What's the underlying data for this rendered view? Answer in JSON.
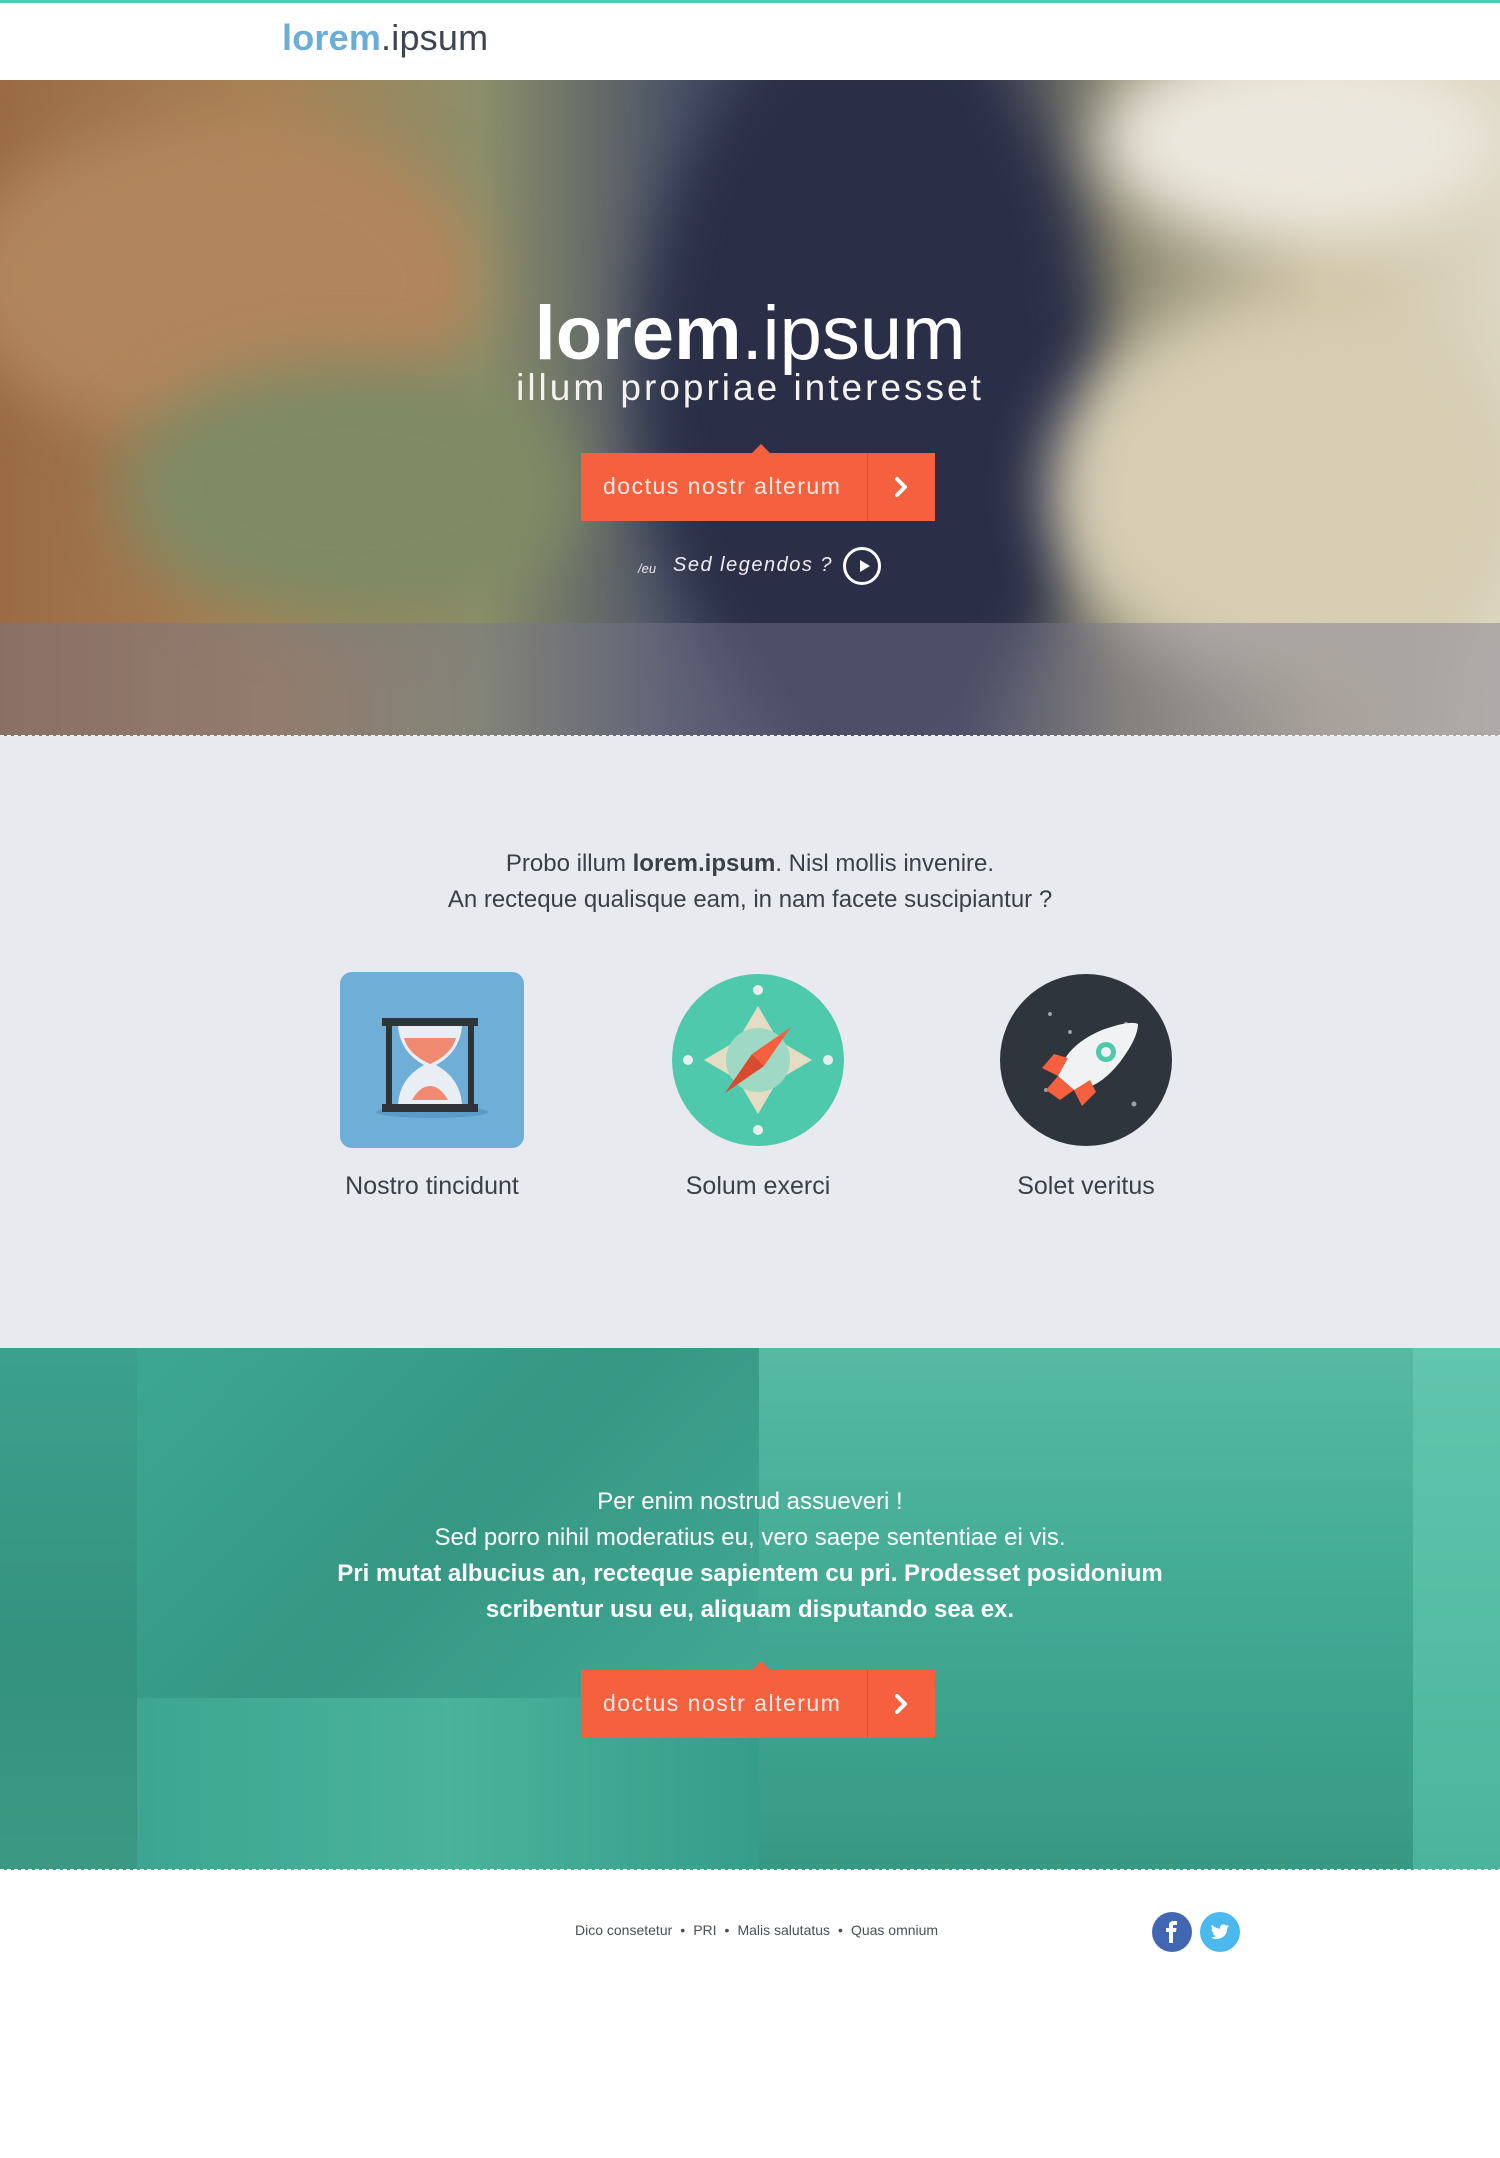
{
  "header": {
    "logo_bold": "lorem",
    "logo_light": ".ipsum"
  },
  "hero": {
    "title_bold": "lorem",
    "title_light": ".ipsum",
    "subtitle": "illum propriae interesset",
    "cta_label": "doctus nostr alterum",
    "question_prefix": "/eu",
    "question": "Sed legendos ?"
  },
  "features": {
    "intro_part1": "Probo illum ",
    "intro_bold": "lorem.ipsum",
    "intro_part2": ". Nisl mollis invenire.",
    "intro_line2": "An recteque qualisque eam, in nam facete suscipiantur ?",
    "items": [
      {
        "label": "Nostro tincidunt",
        "icon": "hourglass-icon"
      },
      {
        "label": "Solum exerci",
        "icon": "compass-icon"
      },
      {
        "label": "Solet veritus",
        "icon": "rocket-icon"
      }
    ]
  },
  "team": {
    "line1": "Per enim nostrud assueveri !",
    "line2": "Sed porro nihil moderatius eu, vero saepe sententiae ei vis.",
    "line3": "Pri mutat albucius an, recteque sapientem cu pri. Prodesset posidonium",
    "line4": "scribentur usu eu, aliquam disputando sea ex.",
    "cta_label": "doctus nostr alterum"
  },
  "footer": {
    "links": [
      "Dico consetetur",
      "PRI",
      "Malis salutatus",
      "Quas omnium"
    ],
    "separator": "•",
    "social": [
      "facebook-icon",
      "twitter-icon"
    ]
  },
  "colors": {
    "accent": "#f5603f",
    "teal": "#4fc9ac",
    "logo_blue": "#6aaed6",
    "facebook": "#4267b2",
    "twitter": "#4bb8ee"
  }
}
